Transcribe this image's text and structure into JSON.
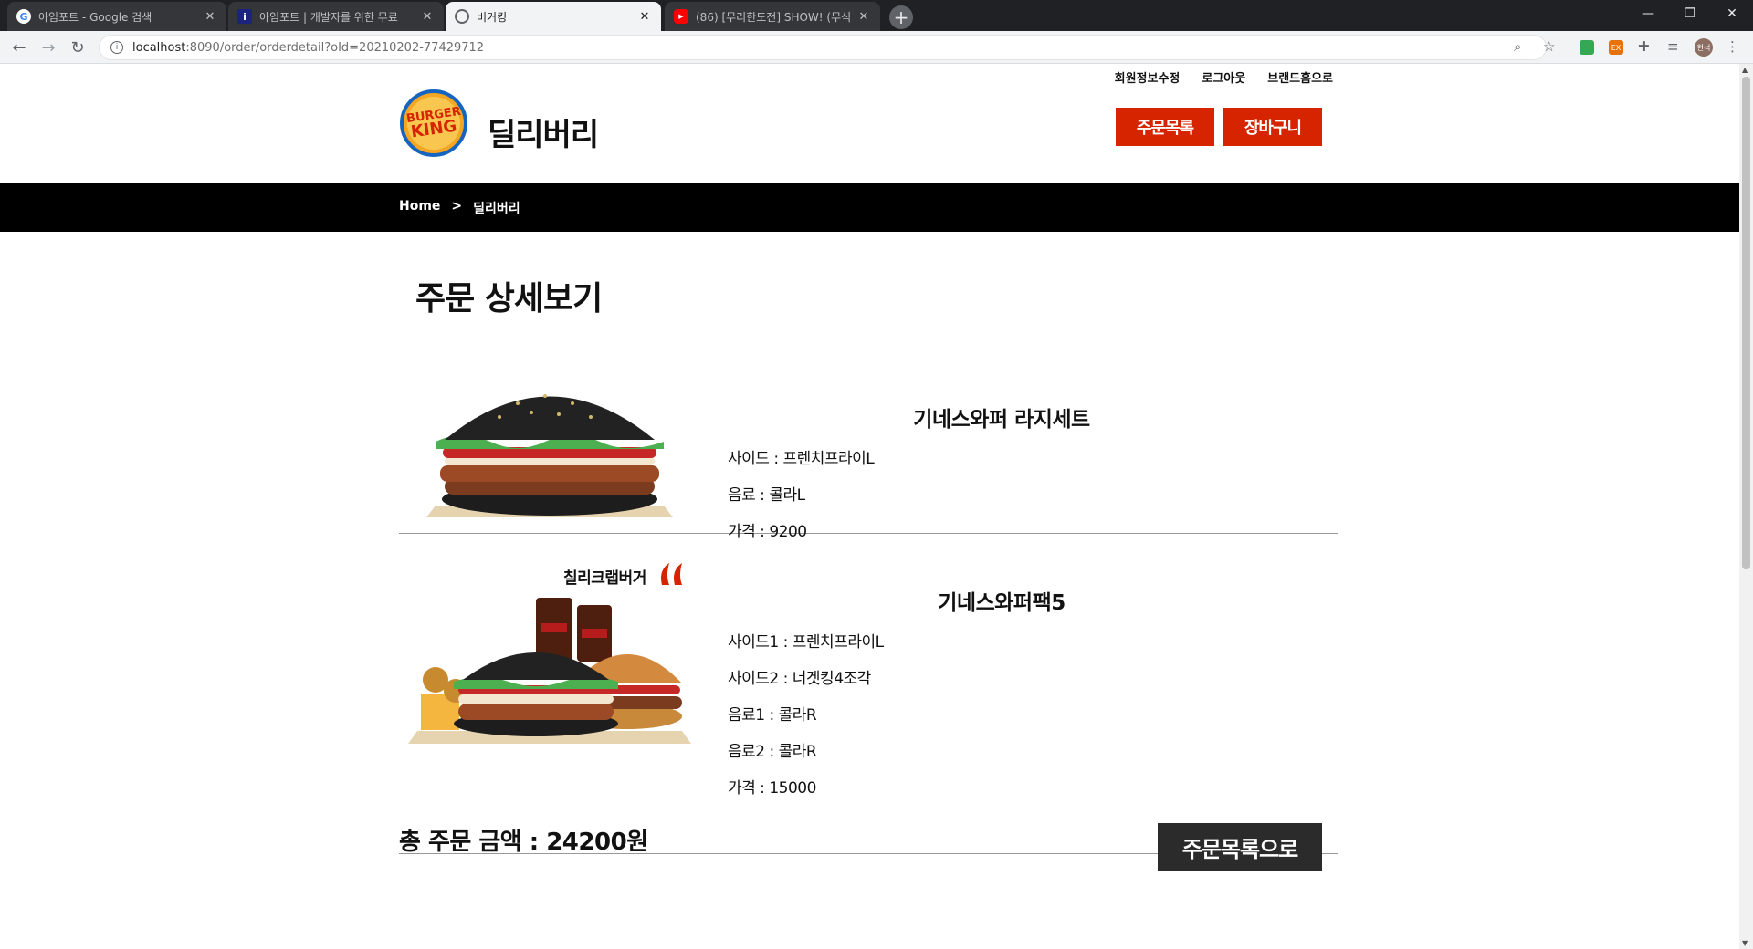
{
  "browser": {
    "tabs": [
      {
        "title": "아임포트 - Google 검색",
        "icon": "google-icon"
      },
      {
        "title": "아임포트 | 개발자를 위한 무료",
        "icon": "iamport-icon"
      },
      {
        "title": "버거킹",
        "icon": "globe-icon"
      },
      {
        "title": "(86) [무리한도전] SHOW! (무식",
        "icon": "youtube-icon"
      }
    ],
    "url_host": "localhost",
    "url_path": ":8090/order/orderdetail?oId=20210202-77429712",
    "profile_label": "현석"
  },
  "header": {
    "util_links": [
      "회원정보수정",
      "로그아웃",
      "브랜드홈으로"
    ],
    "logo_line1": "BURGER",
    "logo_line2": "KING",
    "site_title": "딜리버리",
    "order_list_button": "주문목록",
    "cart_button": "장바구니",
    "brand_color": "#d62300"
  },
  "breadcrumb": {
    "home": "Home",
    "separator": ">",
    "current": "딜리버리"
  },
  "page_title": "주문 상세보기",
  "order_items": [
    {
      "name": "기네스와퍼 라지세트",
      "options": [
        "사이드 : 프렌치프라이L",
        "음료 : 콜라L",
        "가격 : 9200"
      ]
    },
    {
      "name": "기네스와퍼팩5",
      "image_caption": "칠리크랩버거",
      "options": [
        "사이드1 : 프렌치프라이L",
        "사이드2 : 너겟킹4조각",
        "음료1 : 콜라R",
        "음료2 : 콜라R",
        "가격 : 15000"
      ]
    }
  ],
  "total": "총 주문 금액 : 24200원",
  "back_button": "주문목록으로"
}
